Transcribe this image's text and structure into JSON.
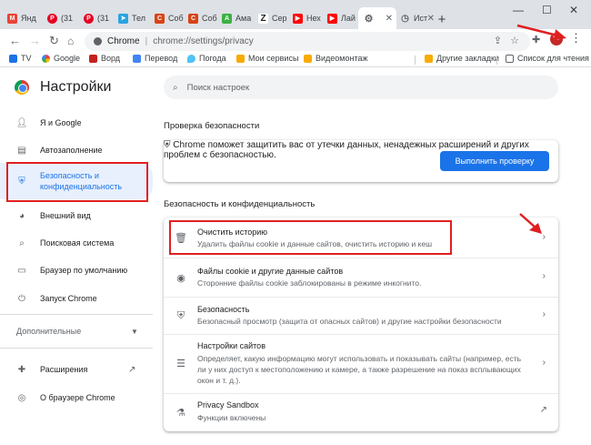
{
  "tabs": [
    {
      "label": "Янд",
      "icon": "gmail-icon",
      "color": "#ea4335"
    },
    {
      "label": "(31",
      "icon": "pinterest-icon",
      "color": "#e60023"
    },
    {
      "label": "(31",
      "icon": "pinterest-icon",
      "color": "#e60023"
    },
    {
      "label": "Тел",
      "icon": "telegram-icon",
      "color": "#2aa3e0"
    },
    {
      "label": "Соб",
      "icon": "sobaka-icon",
      "color": "#d84315"
    },
    {
      "label": "Соб",
      "icon": "sobaka-icon",
      "color": "#d84315"
    },
    {
      "label": "Ама",
      "icon": "ama-icon",
      "color": "#3bb143"
    },
    {
      "label": "Сер",
      "icon": "z-icon",
      "color": "#202124"
    },
    {
      "label": "Нех",
      "icon": "youtube-icon",
      "color": "#ff0000"
    },
    {
      "label": "Лай",
      "icon": "youtube-icon",
      "color": "#ff0000"
    },
    {
      "label": "",
      "icon": "settings-gear-icon",
      "color": "#5f6368"
    },
    {
      "label": "Ист",
      "icon": "history-icon",
      "color": "#5f6368"
    }
  ],
  "window": {
    "minimize": "—",
    "maximize": "☐",
    "close": "✕"
  },
  "omnibox": {
    "host": "Chrome",
    "path": "chrome://settings/privacy"
  },
  "bookmarks": [
    {
      "label": "TV"
    },
    {
      "label": "Google"
    },
    {
      "label": "Ворд"
    },
    {
      "label": "Перевод"
    },
    {
      "label": "Погода"
    },
    {
      "label": "Мои сервисы"
    },
    {
      "label": "Видеомонтаж"
    },
    {
      "label": "Другие закладки"
    },
    {
      "label": "Список для чтения"
    }
  ],
  "settings": {
    "title": "Настройки",
    "search_placeholder": "Поиск настроек",
    "nav": [
      {
        "label": "Я и Google",
        "icon": "person-icon"
      },
      {
        "label": "Автозаполнение",
        "icon": "autofill-icon"
      },
      {
        "label": "Безопасность и конфиденциальность",
        "icon": "shield-icon"
      },
      {
        "label": "Внешний вид",
        "icon": "palette-icon"
      },
      {
        "label": "Поисковая система",
        "icon": "search-icon"
      },
      {
        "label": "Браузер по умолчанию",
        "icon": "browser-icon"
      },
      {
        "label": "Запуск Chrome",
        "icon": "power-icon"
      }
    ],
    "advanced": "Дополнительные",
    "extensions": "Расширения",
    "about": "О браузере Chrome",
    "safety_check": {
      "heading": "Проверка безопасности",
      "text_line1": "Chrome поможет защитить вас от утечки данных, ненадежных",
      "text_line2": "расширений и других проблем с безопасностью.",
      "button": "Выполнить проверку"
    },
    "privacy": {
      "heading": "Безопасность и конфиденциальность",
      "rows": [
        {
          "title": "Очистить историю",
          "subtitle": "Удалить файлы cookie и данные сайтов, очистить историю и кеш",
          "icon": "trash-icon"
        },
        {
          "title": "Файлы cookie и другие данные сайтов",
          "subtitle": "Сторонние файлы cookie заблокированы в режиме инкогнито.",
          "icon": "cookie-icon"
        },
        {
          "title": "Безопасность",
          "subtitle": "Безопасный просмотр (защита от опасных сайтов) и другие настройки безопасности",
          "icon": "security-shield-icon"
        },
        {
          "title": "Настройки сайтов",
          "subtitle_line1": "Определяет, какую информацию могут использовать и показывать сайты (например, есть",
          "subtitle_line2": "ли у них доступ к местоположению и камере, а также разрешение на показ всплывающих",
          "subtitle_line3": "окон и т. д.).",
          "icon": "sliders-icon"
        },
        {
          "title": "Privacy Sandbox",
          "subtitle": "Функции включены",
          "icon": "flask-icon"
        }
      ]
    }
  },
  "colors": {
    "accent": "#1a73e8",
    "highlight": "#e02020",
    "selected_bg": "#e8f0fe"
  }
}
